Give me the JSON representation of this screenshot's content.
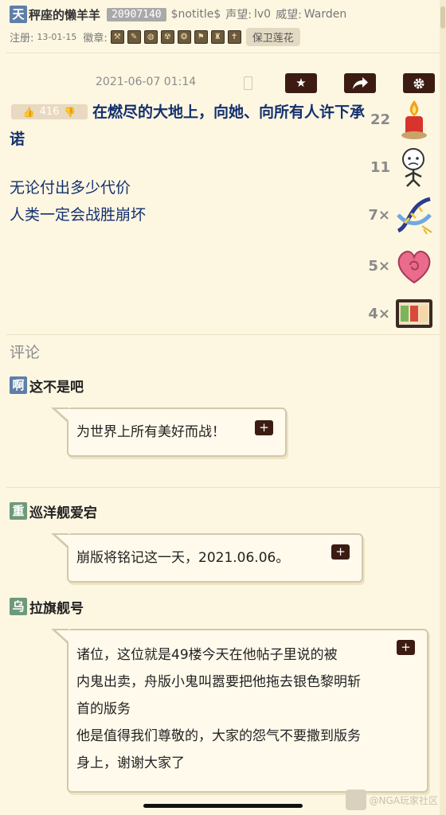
{
  "header": {
    "avatar_char": "天",
    "username": "秤座的懒羊羊",
    "uid": "20907140",
    "notitle": "$notitle$",
    "reputation_label": "声望:",
    "reputation_value": "lv0",
    "prestige_label": "威望:",
    "prestige_value": "Warden",
    "reg_label": "注册:",
    "reg_date": "13-01-15",
    "medal_label": "徽章:",
    "honor_tag": "保卫莲花"
  },
  "post": {
    "timestamp": "2021-06-07 01:14",
    "like_count": "416",
    "line1": "在燃尽的大地上，向她、向所有人许下承诺",
    "line2": "无论付出多少代价",
    "line3": "人类一定会战胜崩坏"
  },
  "actions": {
    "favorite_icon": "star-icon",
    "share_icon": "share-icon",
    "settings_icon": "gear-icon"
  },
  "reactions": [
    {
      "count": "22",
      "icon": "candle"
    },
    {
      "count": "11",
      "icon": "sad-figure"
    },
    {
      "count": "7×",
      "icon": "dna"
    },
    {
      "count": "5×",
      "icon": "heart"
    },
    {
      "count": "4×",
      "icon": "bento"
    }
  ],
  "comments_title": "评论",
  "comments": [
    {
      "avatar_char": "啊",
      "name": "这不是吧",
      "text": "为世界上所有美好而战！"
    },
    {
      "avatar_char": "重",
      "name": "巡洋舰爱宕",
      "text": "崩版将铭记这一天，2021.06.06。"
    },
    {
      "avatar_char": "乌",
      "name": "拉旗舰号",
      "lines": [
        "诸位，这位就是49楼今天在他帖子里说的被",
        "内鬼出卖，舟版小鬼叫嚣要把他拖去银色黎明斩",
        "首的版务",
        "他是值得我们尊敬的，大家的怨气不要撒到版务",
        "身上，谢谢大家了"
      ]
    }
  ],
  "watermark": "@NGA玩家社区",
  "colors": {
    "bg": "#fdf7e2",
    "title_blue": "#14306e",
    "button_dark": "#3c1c12"
  }
}
